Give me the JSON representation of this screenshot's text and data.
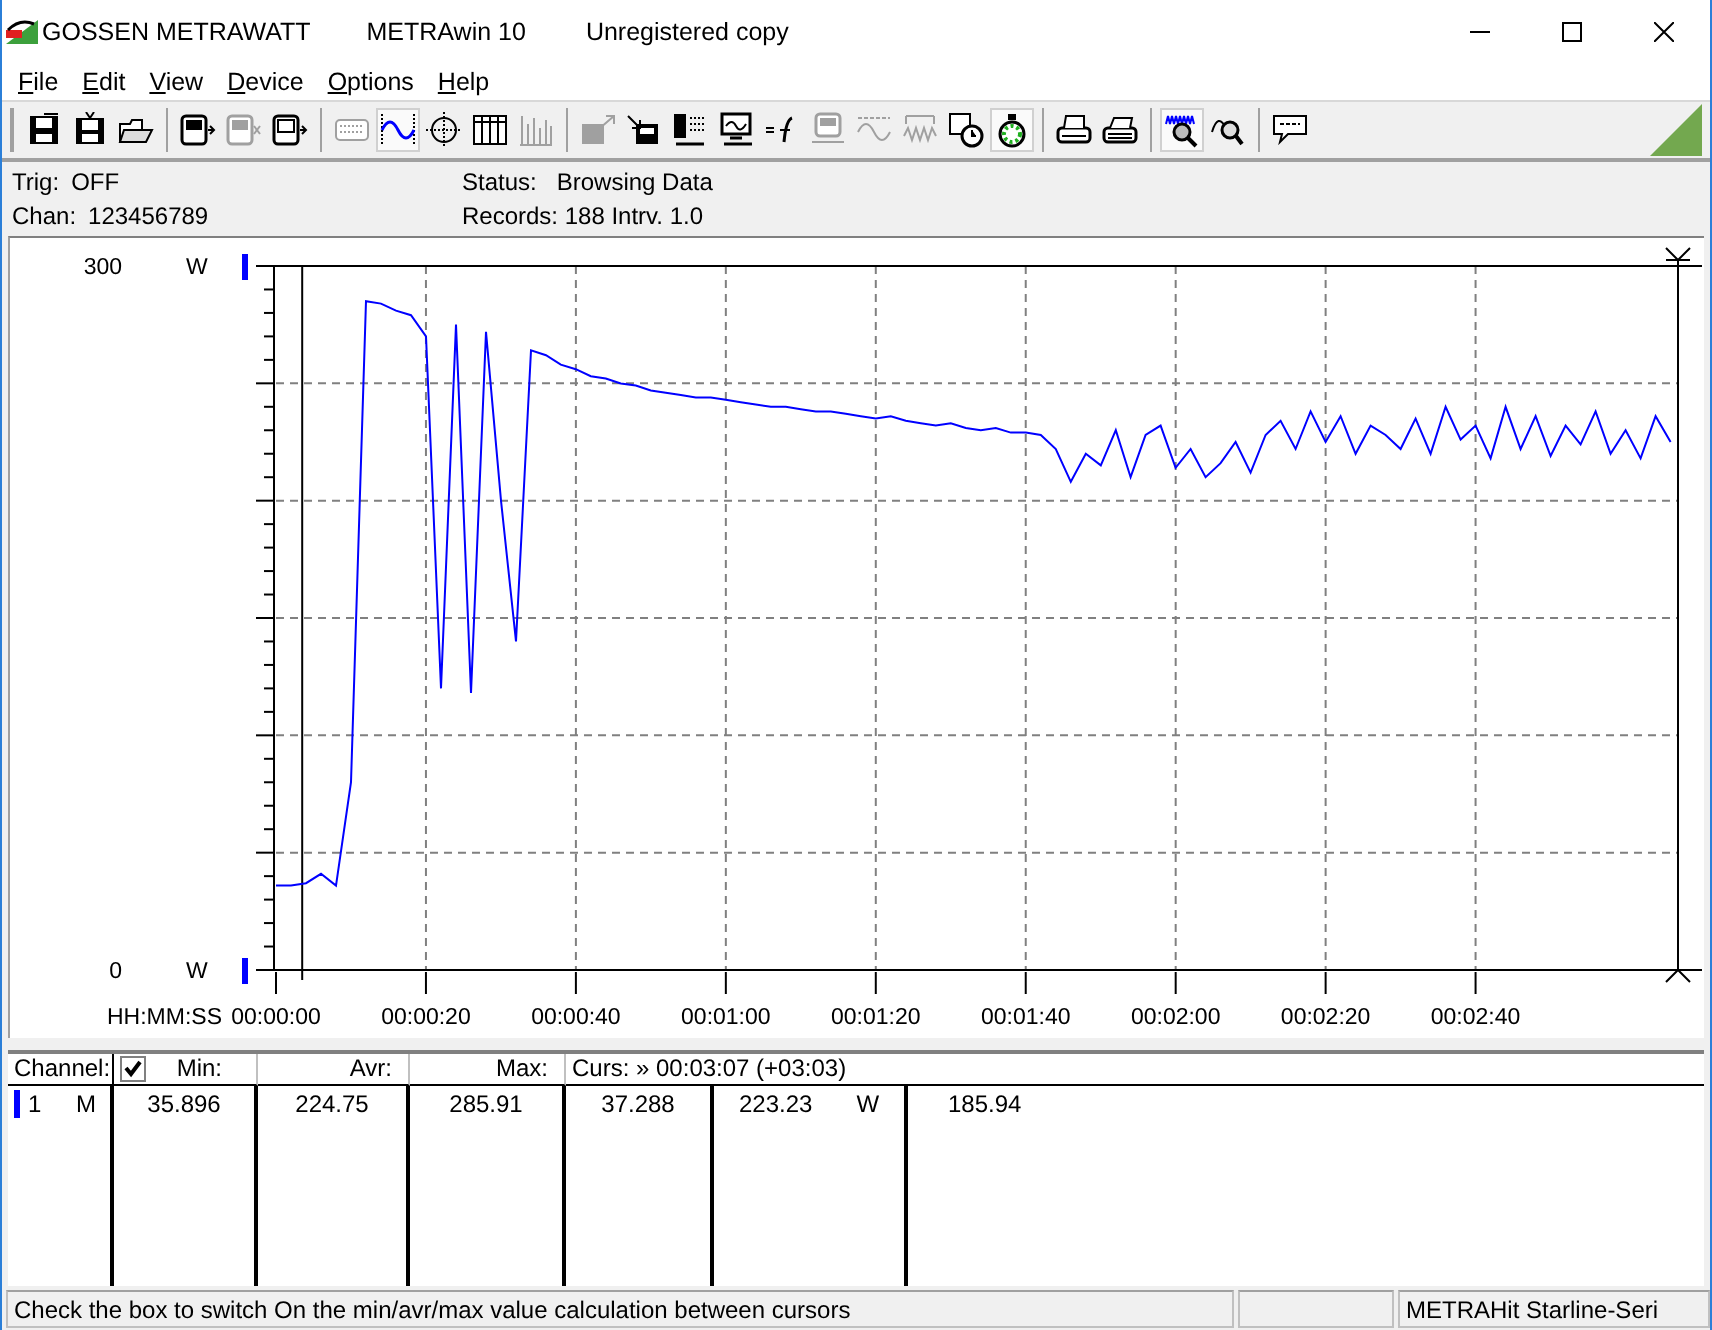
{
  "window": {
    "title_parts": [
      "GOSSEN METRAWATT",
      "METRAwin 10",
      "Unregistered copy"
    ]
  },
  "menu": [
    {
      "label": "File"
    },
    {
      "label": "Edit"
    },
    {
      "label": "View"
    },
    {
      "label": "Device"
    },
    {
      "label": "Options"
    },
    {
      "label": "Help"
    }
  ],
  "toolbar_groups": [
    [
      {
        "pressed": false,
        "disabled": false
      },
      {
        "pressed": false,
        "disabled": false
      },
      {
        "pressed": false,
        "disabled": false
      }
    ],
    [
      {
        "pressed": false,
        "disabled": false
      },
      {
        "pressed": false,
        "disabled": true
      },
      {
        "pressed": false,
        "disabled": false
      }
    ],
    [
      {
        "pressed": false,
        "disabled": true
      },
      {
        "pressed": true,
        "disabled": false
      },
      {
        "pressed": false,
        "disabled": false
      },
      {
        "pressed": false,
        "disabled": false
      },
      {
        "pressed": false,
        "disabled": true
      }
    ],
    [
      {
        "pressed": false,
        "disabled": true
      },
      {
        "pressed": false,
        "disabled": false
      },
      {
        "pressed": false,
        "disabled": false
      },
      {
        "pressed": false,
        "disabled": false
      },
      {
        "pressed": false,
        "disabled": false
      },
      {
        "pressed": false,
        "disabled": true
      },
      {
        "pressed": false,
        "disabled": true
      },
      {
        "pressed": false,
        "disabled": true
      },
      {
        "pressed": false,
        "disabled": false
      },
      {
        "pressed": true,
        "disabled": false
      }
    ],
    [
      {
        "pressed": false,
        "disabled": false
      },
      {
        "pressed": false,
        "disabled": false
      }
    ],
    [
      {
        "pressed": true,
        "disabled": false
      },
      {
        "pressed": false,
        "disabled": false
      }
    ],
    [
      {
        "pressed": false,
        "disabled": false
      }
    ]
  ],
  "info": {
    "left": [
      {
        "label": "Trig:",
        "value": "OFF"
      },
      {
        "label": "Chan:",
        "value": "123456789"
      }
    ],
    "status": {
      "label": "Status:",
      "value": "Browsing Data"
    },
    "records": "Records: 188  Intrv. 1.0"
  },
  "chart": {
    "unit_top": "W",
    "unit_bottom": "W",
    "chart_data": {
      "type": "line",
      "xlabel": "HH:MM:SS",
      "x": [
        0,
        2,
        4,
        6,
        8,
        10,
        12,
        14,
        16,
        18,
        20,
        22,
        24,
        26,
        28,
        30,
        32,
        34,
        36,
        38,
        40,
        42,
        44,
        46,
        48,
        50,
        52,
        54,
        56,
        58,
        60,
        62,
        64,
        66,
        68,
        70,
        72,
        74,
        76,
        78,
        80,
        82,
        84,
        86,
        88,
        90,
        92,
        94,
        96,
        98,
        100,
        102,
        104,
        106,
        108,
        110,
        112,
        114,
        116,
        118,
        120,
        122,
        124,
        126,
        128,
        130,
        132,
        134,
        136,
        138,
        140,
        142,
        144,
        146,
        148,
        150,
        152,
        154,
        156,
        158,
        160,
        162,
        164,
        166,
        168,
        170,
        172,
        174,
        176,
        178,
        180,
        182,
        184,
        186
      ],
      "series": [
        {
          "color": "#0000ff",
          "values": [
            36,
            36,
            37,
            41,
            36,
            80,
            285,
            284,
            281,
            279,
            270,
            120,
            275,
            118,
            272,
            200,
            140,
            264,
            262,
            258,
            256,
            253,
            252,
            250,
            249,
            247,
            246,
            245,
            244,
            244,
            243,
            242,
            241,
            240,
            240,
            239,
            238,
            238,
            237,
            236,
            235,
            236,
            234,
            233,
            232,
            233,
            231,
            230,
            231,
            229,
            229,
            228,
            222,
            208,
            220,
            215,
            230,
            210,
            228,
            232,
            214,
            222,
            210,
            216,
            225,
            212,
            228,
            234,
            222,
            238,
            225,
            236,
            220,
            232,
            228,
            222,
            235,
            220,
            240,
            226,
            232,
            218,
            240,
            222,
            236,
            219,
            232,
            224,
            238,
            220,
            230,
            218,
            236,
            225
          ]
        }
      ],
      "xlim": [
        0,
        187
      ],
      "ylim": [
        0,
        300
      ],
      "grid": true,
      "ref_lines": [
        {
          "axis": "x",
          "value": 3.5
        },
        {
          "axis": "x",
          "value": 187
        }
      ],
      "xticks": [
        {
          "value": 0,
          "label": "00:00:00"
        },
        {
          "value": 20,
          "label": "00:00:20"
        },
        {
          "value": 40,
          "label": "00:00:40"
        },
        {
          "value": 60,
          "label": "00:01:00"
        },
        {
          "value": 80,
          "label": "00:01:20"
        },
        {
          "value": 100,
          "label": "00:01:40"
        },
        {
          "value": 120,
          "label": "00:02:00"
        },
        {
          "value": 140,
          "label": "00:02:20"
        },
        {
          "value": 160,
          "label": "00:02:40"
        }
      ],
      "yticks": [
        {
          "value": 0,
          "label": "0"
        },
        {
          "value": 300,
          "label": "300"
        }
      ]
    }
  },
  "table": {
    "header": {
      "channel": "Channel:",
      "checked": true,
      "min": "Min:",
      "avr": "Avr:",
      "max": "Max:",
      "cursor": "Curs: » 00:03:07 (+03:03)"
    },
    "rows": [
      {
        "color": "#0000ff",
        "number": "1",
        "mode": "M",
        "min": "35.896",
        "avr": "224.75",
        "max": "285.91",
        "cursor_1": "37.288",
        "cursor_2": "223.23",
        "unit": "W",
        "delta": "185.94"
      }
    ]
  },
  "status_bar": {
    "message": "Check the box to switch On the min/avr/max value calculation between cursors",
    "device": "METRAHit Starline-Seri"
  }
}
